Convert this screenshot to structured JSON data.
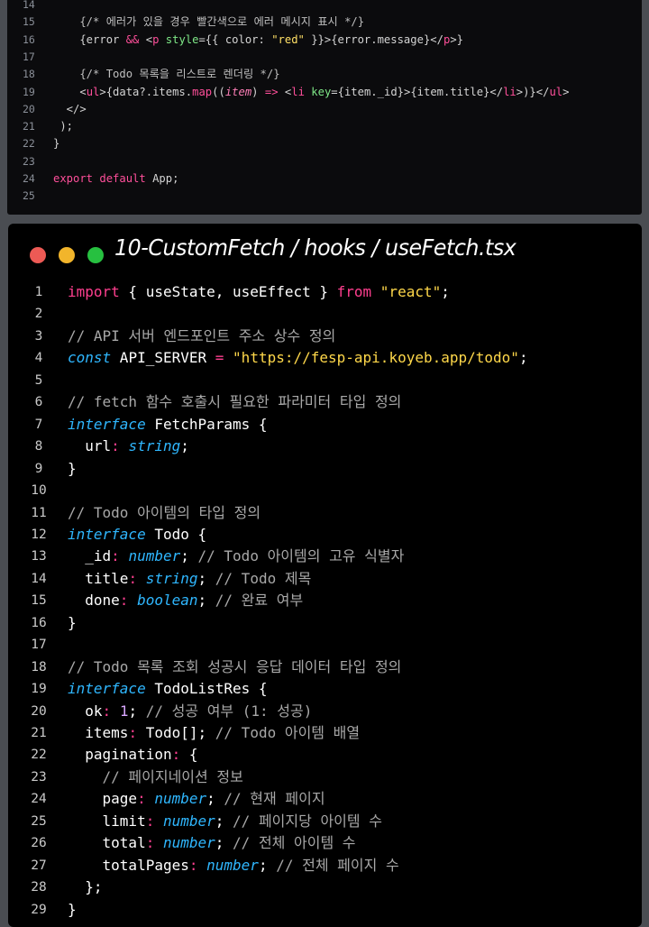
{
  "top_editor": {
    "lines": [
      {
        "num": "14",
        "tokens": []
      },
      {
        "num": "15",
        "tokens": [
          {
            "t": "    {/* 에러가 있을 경우 빨간색으로 에러 메시지 표시 */}",
            "c": "ttk-comment"
          }
        ]
      },
      {
        "num": "16",
        "tokens": [
          {
            "t": "    {error ",
            "c": ""
          },
          {
            "t": "&&",
            "c": "ttk-kw"
          },
          {
            "t": " <",
            "c": ""
          },
          {
            "t": "p",
            "c": "ttk-tag"
          },
          {
            "t": " ",
            "c": ""
          },
          {
            "t": "style",
            "c": "ttk-attr"
          },
          {
            "t": "={{ color: ",
            "c": ""
          },
          {
            "t": "\"red\"",
            "c": "ttk-str"
          },
          {
            "t": " }}>{error.message}</",
            "c": ""
          },
          {
            "t": "p",
            "c": "ttk-tag"
          },
          {
            "t": ">}",
            "c": ""
          }
        ]
      },
      {
        "num": "17",
        "tokens": []
      },
      {
        "num": "18",
        "tokens": [
          {
            "t": "    {/* Todo 목록을 리스트로 렌더링 */}",
            "c": "ttk-comment"
          }
        ]
      },
      {
        "num": "19",
        "tokens": [
          {
            "t": "    <",
            "c": ""
          },
          {
            "t": "ul",
            "c": "ttk-tag"
          },
          {
            "t": ">{data?.items.",
            "c": ""
          },
          {
            "t": "map",
            "c": "ttk-kw"
          },
          {
            "t": "((",
            "c": ""
          },
          {
            "t": "item",
            "c": "ttk-italic"
          },
          {
            "t": ") ",
            "c": ""
          },
          {
            "t": "=>",
            "c": "ttk-kw"
          },
          {
            "t": " <",
            "c": ""
          },
          {
            "t": "li",
            "c": "ttk-tag"
          },
          {
            "t": " ",
            "c": ""
          },
          {
            "t": "key",
            "c": "ttk-attr"
          },
          {
            "t": "={item._id}>{item.title}</",
            "c": ""
          },
          {
            "t": "li",
            "c": "ttk-tag"
          },
          {
            "t": ">)}</",
            "c": ""
          },
          {
            "t": "ul",
            "c": "ttk-tag"
          },
          {
            "t": ">",
            "c": ""
          }
        ]
      },
      {
        "num": "20",
        "tokens": [
          {
            "t": "  </>",
            "c": ""
          }
        ]
      },
      {
        "num": "21",
        "tokens": [
          {
            "t": " );",
            "c": ""
          }
        ]
      },
      {
        "num": "22",
        "tokens": [
          {
            "t": "}",
            "c": ""
          }
        ]
      },
      {
        "num": "23",
        "tokens": []
      },
      {
        "num": "24",
        "tokens": [
          {
            "t": "export default",
            "c": "ttk-kw"
          },
          {
            "t": " App;",
            "c": ""
          }
        ]
      },
      {
        "num": "25",
        "tokens": []
      }
    ]
  },
  "bottom_editor": {
    "file_title": "10-CustomFetch / hooks / useFetch.tsx",
    "colors": {
      "red": "#ed5a55",
      "yellow": "#f2b52b",
      "green": "#27c040"
    },
    "lines": [
      {
        "num": "1",
        "tokens": [
          {
            "t": "import",
            "c": "t-pink"
          },
          {
            "t": " { useState, useEffect } ",
            "c": "t-id"
          },
          {
            "t": "from",
            "c": "t-pink"
          },
          {
            "t": " ",
            "c": ""
          },
          {
            "t": "\"react\"",
            "c": "t-str"
          },
          {
            "t": ";",
            "c": "t-punct"
          }
        ]
      },
      {
        "num": "2",
        "tokens": []
      },
      {
        "num": "3",
        "tokens": [
          {
            "t": "// API 서버 엔드포인트 주소 상수 정의",
            "c": "t-comment"
          }
        ]
      },
      {
        "num": "4",
        "tokens": [
          {
            "t": "const",
            "c": "t-kw"
          },
          {
            "t": " API_SERVER ",
            "c": "t-id"
          },
          {
            "t": "=",
            "c": "t-pink"
          },
          {
            "t": " ",
            "c": ""
          },
          {
            "t": "\"https://fesp-api.koyeb.app/todo\"",
            "c": "t-str"
          },
          {
            "t": ";",
            "c": "t-punct"
          }
        ]
      },
      {
        "num": "5",
        "tokens": []
      },
      {
        "num": "6",
        "tokens": [
          {
            "t": "// fetch 함수 호출시 필요한 파라미터 타입 정의",
            "c": "t-comment"
          }
        ]
      },
      {
        "num": "7",
        "tokens": [
          {
            "t": "interface",
            "c": "t-kw"
          },
          {
            "t": " FetchParams {",
            "c": "t-id"
          }
        ]
      },
      {
        "num": "8",
        "tokens": [
          {
            "t": "  url",
            "c": "t-id"
          },
          {
            "t": ":",
            "c": "t-pink"
          },
          {
            "t": " ",
            "c": ""
          },
          {
            "t": "string",
            "c": "t-kw"
          },
          {
            "t": ";",
            "c": "t-punct"
          }
        ]
      },
      {
        "num": "9",
        "tokens": [
          {
            "t": "}",
            "c": "t-id"
          }
        ]
      },
      {
        "num": "10",
        "tokens": []
      },
      {
        "num": "11",
        "tokens": [
          {
            "t": "// Todo 아이템의 타입 정의",
            "c": "t-comment"
          }
        ]
      },
      {
        "num": "12",
        "tokens": [
          {
            "t": "interface",
            "c": "t-kw"
          },
          {
            "t": " Todo {",
            "c": "t-id"
          }
        ]
      },
      {
        "num": "13",
        "tokens": [
          {
            "t": "  _id",
            "c": "t-id"
          },
          {
            "t": ":",
            "c": "t-pink"
          },
          {
            "t": " ",
            "c": ""
          },
          {
            "t": "number",
            "c": "t-kw"
          },
          {
            "t": "; ",
            "c": "t-punct"
          },
          {
            "t": "// Todo 아이템의 고유 식별자",
            "c": "t-comment"
          }
        ]
      },
      {
        "num": "14",
        "tokens": [
          {
            "t": "  title",
            "c": "t-id"
          },
          {
            "t": ":",
            "c": "t-pink"
          },
          {
            "t": " ",
            "c": ""
          },
          {
            "t": "string",
            "c": "t-kw"
          },
          {
            "t": "; ",
            "c": "t-punct"
          },
          {
            "t": "// Todo 제목",
            "c": "t-comment"
          }
        ]
      },
      {
        "num": "15",
        "tokens": [
          {
            "t": "  done",
            "c": "t-id"
          },
          {
            "t": ":",
            "c": "t-pink"
          },
          {
            "t": " ",
            "c": ""
          },
          {
            "t": "boolean",
            "c": "t-kw"
          },
          {
            "t": "; ",
            "c": "t-punct"
          },
          {
            "t": "// 완료 여부",
            "c": "t-comment"
          }
        ]
      },
      {
        "num": "16",
        "tokens": [
          {
            "t": "}",
            "c": "t-id"
          }
        ]
      },
      {
        "num": "17",
        "tokens": []
      },
      {
        "num": "18",
        "tokens": [
          {
            "t": "// Todo 목록 조회 성공시 응답 데이터 타입 정의",
            "c": "t-comment"
          }
        ]
      },
      {
        "num": "19",
        "tokens": [
          {
            "t": "interface",
            "c": "t-kw"
          },
          {
            "t": " TodoListRes {",
            "c": "t-id"
          }
        ]
      },
      {
        "num": "20",
        "tokens": [
          {
            "t": "  ok",
            "c": "t-id"
          },
          {
            "t": ":",
            "c": "t-pink"
          },
          {
            "t": " ",
            "c": ""
          },
          {
            "t": "1",
            "c": "t-num"
          },
          {
            "t": "; ",
            "c": "t-punct"
          },
          {
            "t": "// 성공 여부 (1: 성공)",
            "c": "t-comment"
          }
        ]
      },
      {
        "num": "21",
        "tokens": [
          {
            "t": "  items",
            "c": "t-id"
          },
          {
            "t": ":",
            "c": "t-pink"
          },
          {
            "t": " Todo[]; ",
            "c": "t-id"
          },
          {
            "t": "// Todo 아이템 배열",
            "c": "t-comment"
          }
        ]
      },
      {
        "num": "22",
        "tokens": [
          {
            "t": "  pagination",
            "c": "t-id"
          },
          {
            "t": ":",
            "c": "t-pink"
          },
          {
            "t": " {",
            "c": "t-id"
          }
        ]
      },
      {
        "num": "23",
        "tokens": [
          {
            "t": "    // 페이지네이션 정보",
            "c": "t-comment"
          }
        ]
      },
      {
        "num": "24",
        "tokens": [
          {
            "t": "    page",
            "c": "t-id"
          },
          {
            "t": ":",
            "c": "t-pink"
          },
          {
            "t": " ",
            "c": ""
          },
          {
            "t": "number",
            "c": "t-kw"
          },
          {
            "t": "; ",
            "c": "t-punct"
          },
          {
            "t": "// 현재 페이지",
            "c": "t-comment"
          }
        ]
      },
      {
        "num": "25",
        "tokens": [
          {
            "t": "    limit",
            "c": "t-id"
          },
          {
            "t": ":",
            "c": "t-pink"
          },
          {
            "t": " ",
            "c": ""
          },
          {
            "t": "number",
            "c": "t-kw"
          },
          {
            "t": "; ",
            "c": "t-punct"
          },
          {
            "t": "// 페이지당 아이템 수",
            "c": "t-comment"
          }
        ]
      },
      {
        "num": "26",
        "tokens": [
          {
            "t": "    total",
            "c": "t-id"
          },
          {
            "t": ":",
            "c": "t-pink"
          },
          {
            "t": " ",
            "c": ""
          },
          {
            "t": "number",
            "c": "t-kw"
          },
          {
            "t": "; ",
            "c": "t-punct"
          },
          {
            "t": "// 전체 아이템 수",
            "c": "t-comment"
          }
        ]
      },
      {
        "num": "27",
        "tokens": [
          {
            "t": "    totalPages",
            "c": "t-id"
          },
          {
            "t": ":",
            "c": "t-pink"
          },
          {
            "t": " ",
            "c": ""
          },
          {
            "t": "number",
            "c": "t-kw"
          },
          {
            "t": "; ",
            "c": "t-punct"
          },
          {
            "t": "// 전체 페이지 수",
            "c": "t-comment"
          }
        ]
      },
      {
        "num": "28",
        "tokens": [
          {
            "t": "  };",
            "c": "t-id"
          }
        ]
      },
      {
        "num": "29",
        "tokens": [
          {
            "t": "}",
            "c": "t-id"
          }
        ]
      }
    ]
  }
}
